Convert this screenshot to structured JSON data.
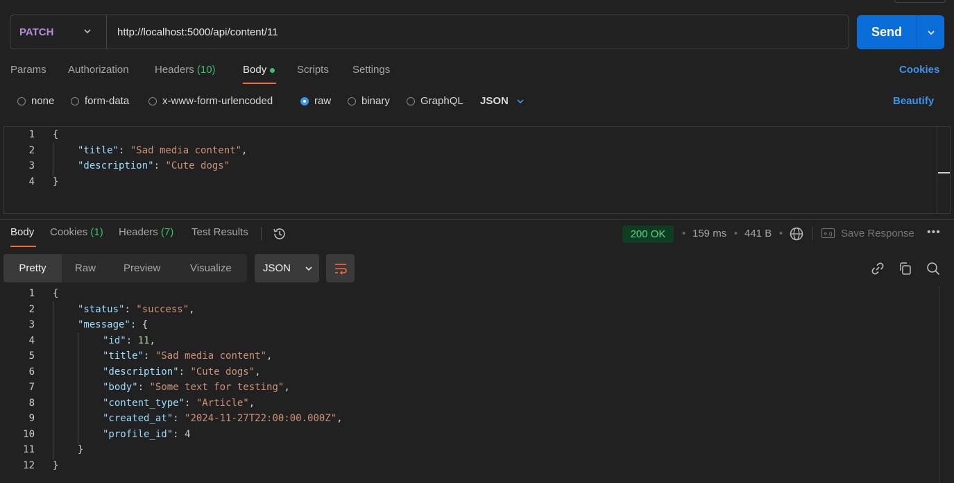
{
  "request": {
    "method": "PATCH",
    "url": "http://localhost:5000/api/content/11",
    "send_label": "Send"
  },
  "request_tabs": [
    {
      "label": "Params"
    },
    {
      "label": "Authorization"
    },
    {
      "label": "Headers",
      "count": "(10)"
    },
    {
      "label": "Body",
      "active": true
    },
    {
      "label": "Scripts"
    },
    {
      "label": "Settings"
    }
  ],
  "cookies_link": "Cookies",
  "body_types": [
    "none",
    "form-data",
    "x-www-form-urlencoded",
    "raw",
    "binary",
    "GraphQL"
  ],
  "body_type_selected": "raw",
  "raw_format": "JSON",
  "beautify_label": "Beautify",
  "request_body_lines": [
    "1",
    "2",
    "3",
    "4"
  ],
  "request_body": {
    "title_key": "\"title\"",
    "title_value": "\"Sad media content\"",
    "description_key": "\"description\"",
    "description_value": "\"Cute dogs\""
  },
  "response_tabs": [
    {
      "label": "Body",
      "active": true
    },
    {
      "label": "Cookies",
      "count": "(1)"
    },
    {
      "label": "Headers",
      "count": "(7)"
    },
    {
      "label": "Test Results"
    }
  ],
  "response_meta": {
    "status": "200 OK",
    "time": "159 ms",
    "size": "441 B",
    "save_label": "Save Response",
    "save_icon_text": "e.g"
  },
  "view_modes": [
    "Pretty",
    "Raw",
    "Preview",
    "Visualize"
  ],
  "response_format": "JSON",
  "response_body_lines": [
    "1",
    "2",
    "3",
    "4",
    "5",
    "6",
    "7",
    "8",
    "9",
    "10",
    "11",
    "12"
  ],
  "response_body": {
    "status_key": "\"status\"",
    "status_value": "\"success\"",
    "message_key": "\"message\"",
    "id_key": "\"id\"",
    "id_value": "11",
    "title_key": "\"title\"",
    "title_value": "\"Sad media content\"",
    "description_key": "\"description\"",
    "description_value": "\"Cute dogs\"",
    "body_key": "\"body\"",
    "body_value": "\"Some text for testing\"",
    "content_type_key": "\"content_type\"",
    "content_type_value": "\"Article\"",
    "created_at_key": "\"created_at\"",
    "created_at_value": "\"2024-11-27T22:00:00.000Z\"",
    "profile_id_key": "\"profile_id\"",
    "profile_id_value": "4"
  },
  "colors": {
    "accent": "#0b6dd8",
    "tab_underline": "#f26b3a",
    "status_ok": "#5fd38a",
    "method": "#b78bdc"
  }
}
